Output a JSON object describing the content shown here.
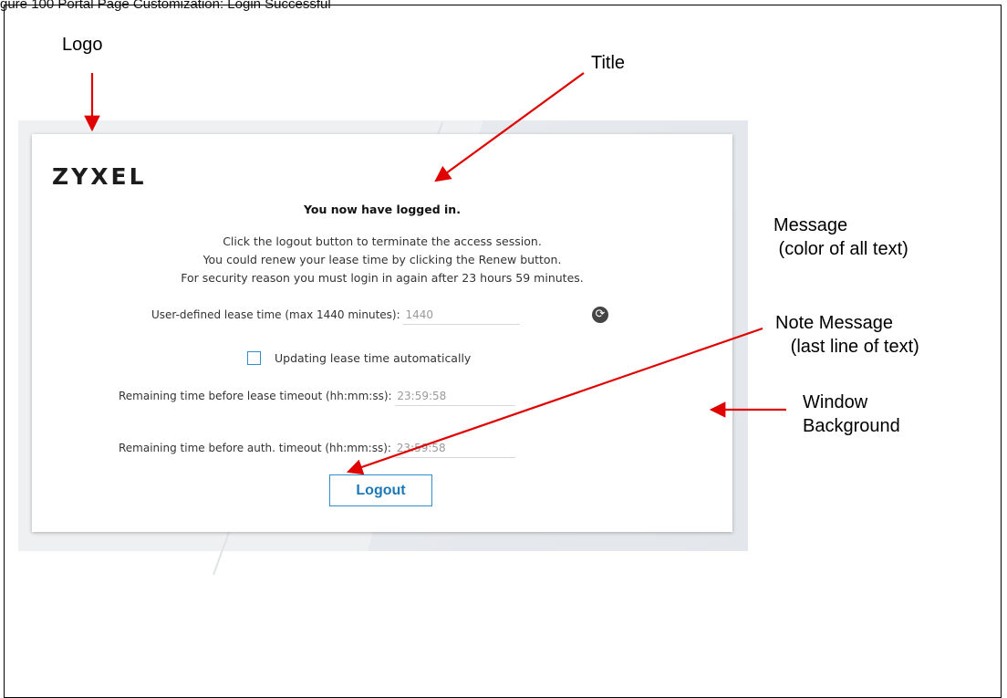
{
  "figure_caption": "gure 100 Portal Page Customization: Login Successful",
  "logo": {
    "text": "ZYXEL"
  },
  "page": {
    "title": "You now have logged in.",
    "messages": [
      "Click the logout button to terminate the access session.",
      "You could renew your lease time by clicking the Renew button.",
      "For security reason you must login in again after 23 hours 59 minutes."
    ]
  },
  "lease": {
    "label": "User-defined lease time (max 1440 minutes):",
    "value": "1440",
    "renew_icon": "refresh-icon"
  },
  "auto_update": {
    "label": "Updating lease time automatically",
    "checked": false
  },
  "remaining_lease": {
    "label": "Remaining time before lease timeout (hh:mm:ss):",
    "value": "23:59:58"
  },
  "remaining_auth": {
    "label": "Remaining time before auth. timeout (hh:mm:ss):",
    "value": "23:59:58"
  },
  "logout_button": {
    "label": "Logout"
  },
  "annotations": {
    "logo": "Logo",
    "title": "Title",
    "message": "Message\n (color of all text)",
    "note_message": "Note Message\n   (last line of text)",
    "window_background": "Window\nBackground"
  },
  "colors": {
    "accent": "#2f8fc8",
    "arrow": "#e00000",
    "window_background": "#eef0f2"
  }
}
